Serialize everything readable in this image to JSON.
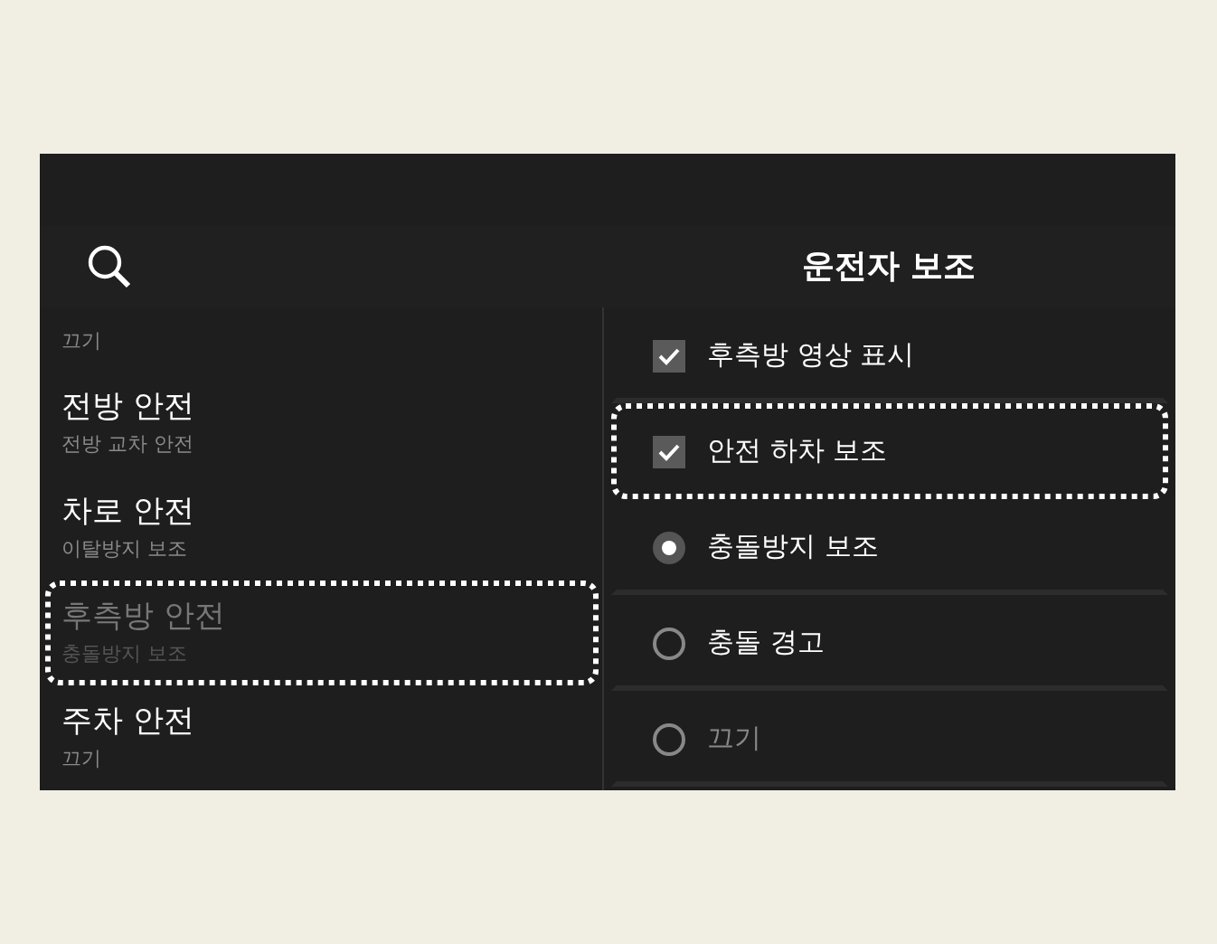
{
  "header": {
    "title": "운전자 보조"
  },
  "categories": [
    {
      "subtitle": "끄기",
      "disabled": false,
      "highlighted": false
    },
    {
      "title": "전방 안전",
      "subtitle": "전방 교차 안전",
      "disabled": false,
      "highlighted": false
    },
    {
      "title": "차로 안전",
      "subtitle": "이탈방지 보조",
      "disabled": false,
      "highlighted": false
    },
    {
      "title": "후측방 안전",
      "subtitle": "충돌방지 보조",
      "disabled": true,
      "highlighted": true
    },
    {
      "title": "주차 안전",
      "subtitle": "끄기",
      "disabled": false,
      "highlighted": false
    }
  ],
  "options": [
    {
      "kind": "checkbox",
      "label": "후측방 영상 표시",
      "checked": true,
      "disabled": false,
      "highlighted": false
    },
    {
      "kind": "checkbox",
      "label": "안전 하차 보조",
      "checked": true,
      "disabled": false,
      "highlighted": true
    },
    {
      "kind": "radio",
      "label": "충돌방지 보조",
      "selected": true,
      "disabled": false,
      "highlighted": false
    },
    {
      "kind": "radio",
      "label": "충돌 경고",
      "selected": false,
      "disabled": false,
      "highlighted": false
    },
    {
      "kind": "radio",
      "label": "끄기",
      "selected": false,
      "disabled": true,
      "highlighted": false
    }
  ]
}
